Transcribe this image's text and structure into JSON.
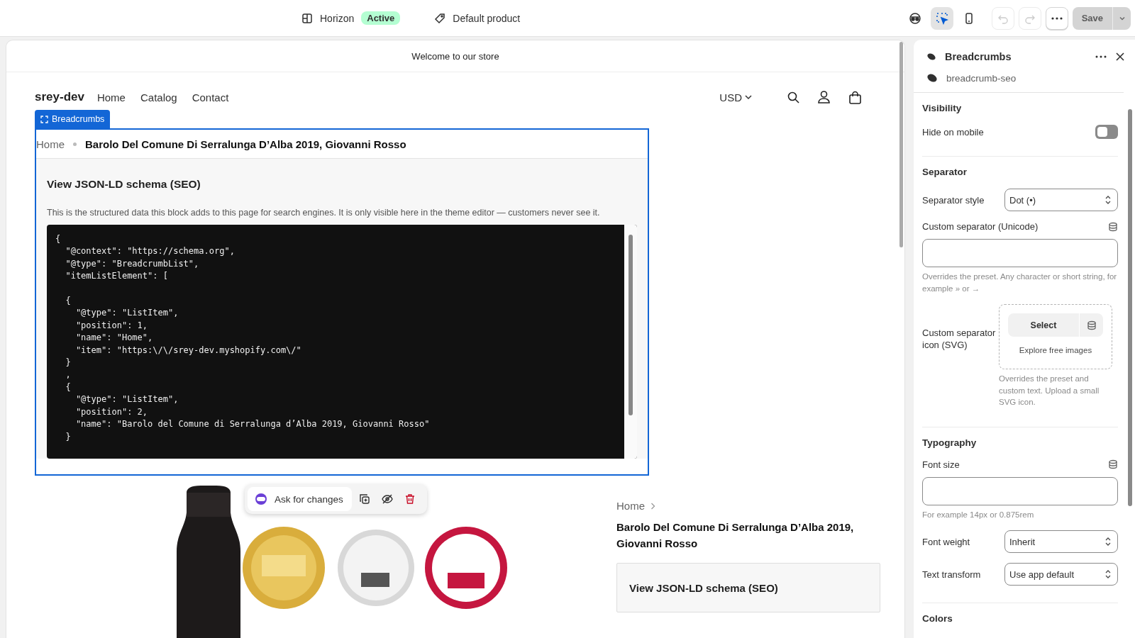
{
  "topbar": {
    "theme": {
      "name": "Horizon",
      "badge": "Active"
    },
    "template": "Default product",
    "tools": [
      {
        "kind": "preview",
        "selected": false
      },
      {
        "kind": "inspector",
        "selected": true
      },
      {
        "kind": "mobile",
        "selected": false
      }
    ],
    "history": [
      {
        "kind": "undo",
        "disabled": true
      },
      {
        "kind": "redo",
        "disabled": true
      }
    ],
    "save": {
      "label": "Save",
      "disabled": true
    }
  },
  "preview": {
    "announcement": "Welcome to our store",
    "header": {
      "logo": "srey-dev",
      "nav": [
        "Home",
        "Catalog",
        "Contact"
      ],
      "currency": "USD"
    },
    "block_tag": "Breadcrumbs",
    "breadcrumb": [
      "Home",
      "Barolo Del Comune Di Serralunga D’Alba 2019, Giovanni Rosso"
    ],
    "schema": {
      "title": "View JSON-LD schema (SEO)",
      "description": "This is the structured data this block adds to this page for search engines. It is only visible here in the theme editor — customers never see it.",
      "code": "{\n  \"@context\": \"https://schema.org\",\n  \"@type\": \"BreadcrumbList\",\n  \"itemListElement\": [\n\n  {\n    \"@type\": \"ListItem\",\n    \"position\": 1,\n    \"name\": \"Home\",\n    \"item\": \"https:\\/\\/srey-dev.myshopify.com\\/\"\n  }\n  ,\n  {\n    \"@type\": \"ListItem\",\n    \"position\": 2,\n    \"name\": \"Barolo del Comune di Serralunga d’Alba 2019, Giovanni Rosso\"\n  }"
    },
    "product": {
      "picture": {
        "kind": "picture"
      },
      "toolbar": {
        "label": "Ask for changes"
      },
      "breadcrumb": [
        "Home"
      ],
      "title": "Barolo Del Comune Di Serralunga D’Alba 2019, Giovanni Rosso",
      "schema_button": "View JSON-LD schema (SEO)"
    }
  },
  "panel": {
    "title": "Breadcrumbs",
    "subtitle": "breadcrumb-seo",
    "sections": [
      {
        "title": "Visibility",
        "fields": [
          {
            "kind": "toggle",
            "label": "Hide on mobile",
            "on": false
          }
        ]
      },
      {
        "title": "Separator",
        "fields": [
          {
            "kind": "select",
            "label": "Separator style",
            "value": "Dot (•)"
          },
          {
            "kind": "text",
            "label": "Custom separator (Unicode)",
            "help": "Overrides the preset. Any character or short string, for example » or →"
          },
          {
            "label": "Custom separator icon (SVG)",
            "button": "Select",
            "link": "Explore free images",
            "help": "Overrides the preset and custom text. Upload a small SVG icon."
          }
        ]
      },
      {
        "title": "Typography",
        "fields": [
          {
            "kind": "text",
            "label": "Font size",
            "help": "For example 14px or 0.875rem"
          },
          {
            "kind": "select",
            "label": "Font weight",
            "value": "Inherit"
          },
          {
            "kind": "select",
            "label": "Text transform",
            "value": "Use app default"
          }
        ]
      },
      {
        "title": "Colors"
      }
    ]
  }
}
